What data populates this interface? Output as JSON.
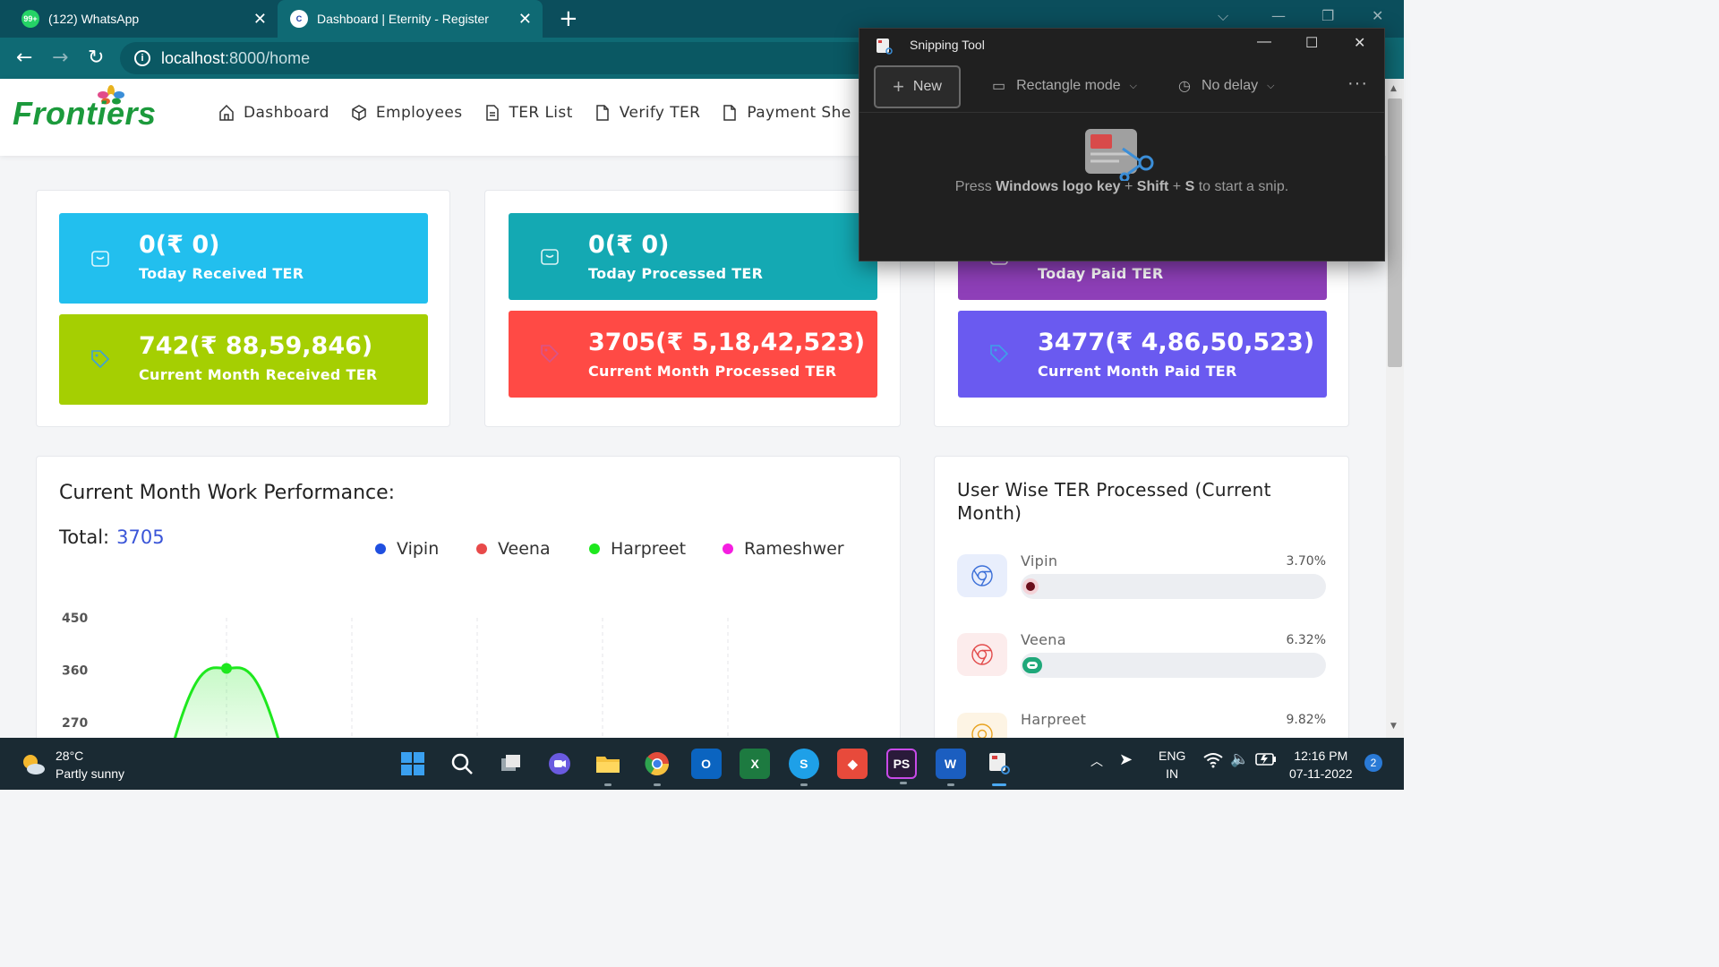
{
  "browser": {
    "tabs": [
      {
        "badge": "99+",
        "title": "(122) WhatsApp"
      },
      {
        "badge": "C",
        "title": "Dashboard | Eternity - Register"
      }
    ],
    "close_glyph": "✕",
    "new_tab_glyph": "+",
    "url_host": "localhost",
    "url_path": ":8000/home"
  },
  "app": {
    "logo_text": "Frontiers",
    "nav": [
      {
        "label": "Dashboard",
        "icon": "home-icon"
      },
      {
        "label": "Employees",
        "icon": "cube-icon"
      },
      {
        "label": "TER List",
        "icon": "document-list-icon"
      },
      {
        "label": "Verify TER",
        "icon": "document-icon"
      },
      {
        "label": "Payment She",
        "icon": "document-icon"
      }
    ]
  },
  "stats": {
    "today_received": {
      "value": "0(₹ 0)",
      "label": "Today Received TER"
    },
    "month_received": {
      "value": "742(₹ 88,59,846)",
      "label": "Current Month Received TER"
    },
    "today_processed": {
      "value": "0(₹ 0)",
      "label": "Today Processed TER"
    },
    "month_processed": {
      "value": "3705(₹ 5,18,42,523)",
      "label": "Current Month Processed TER"
    },
    "today_paid": {
      "label": "Today Paid TER"
    },
    "month_paid": {
      "value": "3477(₹ 4,86,50,523)",
      "label": "Current Month Paid TER"
    }
  },
  "performance": {
    "title": "Current Month Work Performance:",
    "total_label": "Total:",
    "total_value": "3705",
    "legend": [
      {
        "name": "Vipin",
        "color": "#1f4fe0"
      },
      {
        "name": "Veena",
        "color": "#e84a4a"
      },
      {
        "name": "Harpreet",
        "color": "#1ee81e"
      },
      {
        "name": "Rameshwer",
        "color": "#f51ee0"
      }
    ]
  },
  "chart_data": {
    "type": "area",
    "y_ticks": [
      "450",
      "360",
      "270"
    ],
    "ylim": [
      270,
      450
    ],
    "series": [
      {
        "name": "Harpreet",
        "color": "#1ee81e",
        "peak_value": 363
      }
    ]
  },
  "user_wise": {
    "title": "User Wise TER Processed (Current Month)",
    "rows": [
      {
        "name": "Vipin",
        "percent": "3.70%",
        "fraction": 0.037,
        "color": "#6a0f1c",
        "icon_color": "#3b6fd8",
        "icon_bg": "#e8eefc"
      },
      {
        "name": "Veena",
        "percent": "6.32%",
        "fraction": 0.0632,
        "color": "#1fa87a",
        "icon_color": "#e24b4b",
        "icon_bg": "#fcecec"
      },
      {
        "name": "Harpreet",
        "percent": "9.82%",
        "fraction": 0.0982,
        "color": "#e8b21e",
        "icon_color": "#e8a21e",
        "icon_bg": "#fdf4e4"
      }
    ]
  },
  "snipping_tool": {
    "title": "Snipping Tool",
    "new_label": "New",
    "mode_label": "Rectangle mode",
    "delay_label": "No delay",
    "more_glyph": "···",
    "hint_pre": "Press ",
    "hint_key1": "Windows logo key",
    "hint_plus1": " + ",
    "hint_key2": "Shift",
    "hint_plus2": " + ",
    "hint_key3": "S",
    "hint_post": " to start a snip."
  },
  "taskbar": {
    "temperature": "28°C",
    "weather": "Partly sunny",
    "lang_top": "ENG",
    "lang_bottom": "IN",
    "time": "12:16 PM",
    "date": "07-11-2022",
    "notifications": "2"
  }
}
